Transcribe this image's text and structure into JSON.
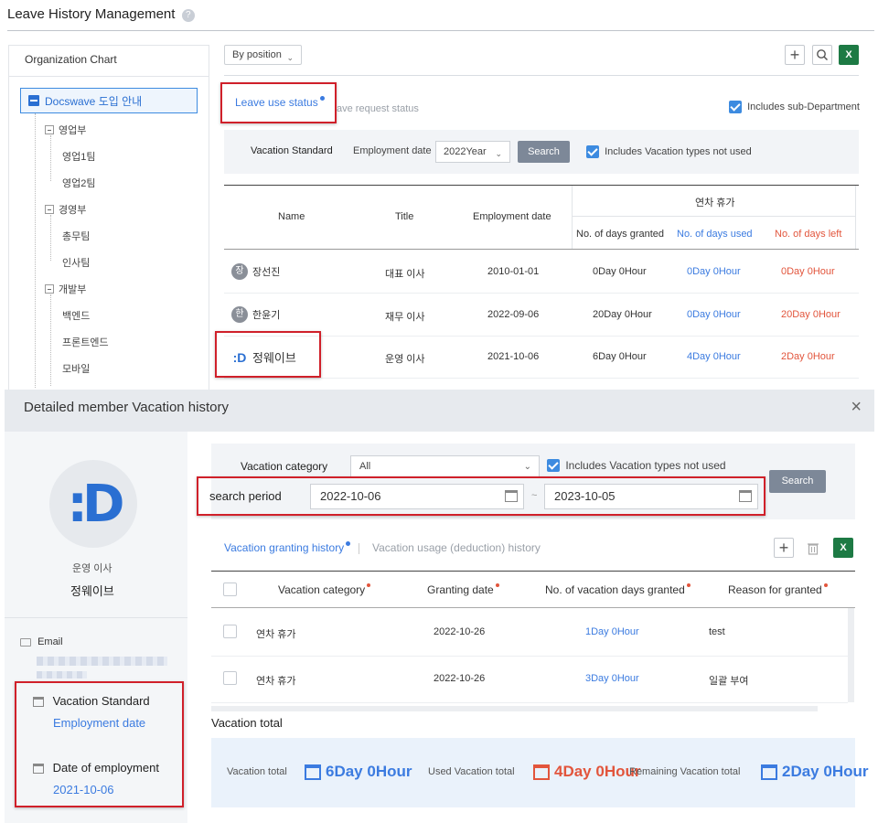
{
  "page": {
    "title": "Leave History Management",
    "help": "?"
  },
  "org": {
    "header": "Organization Chart",
    "root": "Docswave 도입 안내",
    "items": [
      {
        "label": "영업부",
        "level": 1
      },
      {
        "label": "영업1팀",
        "level": 2
      },
      {
        "label": "영업2팀",
        "level": 2
      },
      {
        "label": "경영부",
        "level": 1
      },
      {
        "label": "총무팀",
        "level": 2
      },
      {
        "label": "인사팀",
        "level": 2
      },
      {
        "label": "개발부",
        "level": 1
      },
      {
        "label": "백엔드",
        "level": 2
      },
      {
        "label": "프론트엔드",
        "level": 2
      },
      {
        "label": "모바일",
        "level": 2
      }
    ]
  },
  "toolbar": {
    "view_select": "By position"
  },
  "tabs": {
    "active": "Leave use status",
    "inactive": "ave request status"
  },
  "subdept_label": "Includes sub-Department",
  "filter": {
    "vacation_standard_label": "Vacation Standard",
    "employment_label": "Employment date",
    "year_value": "2022Year",
    "search_label": "Search",
    "not_used_label": "Includes Vacation types not used"
  },
  "table": {
    "headers": {
      "name": "Name",
      "title": "Title",
      "employment": "Employment date",
      "group": "연차 휴가",
      "granted": "No. of days granted",
      "used": "No. of days used",
      "left": "No. of days left"
    },
    "rows": [
      {
        "initial": "장",
        "name": "장선진",
        "title": "대표 이사",
        "date": "2010-01-01",
        "granted": "0Day 0Hour",
        "used": "0Day 0Hour",
        "left": "0Day 0Hour"
      },
      {
        "initial": "한",
        "name": "한윤기",
        "title": "재무 이사",
        "date": "2022-09-06",
        "granted": "20Day 0Hour",
        "used": "0Day 0Hour",
        "left": "20Day 0Hour"
      },
      {
        "initial": ":D",
        "name": "정웨이브",
        "title": "운영 이사",
        "date": "2021-10-06",
        "granted": "6Day 0Hour",
        "used": "4Day 0Hour",
        "left": "2Day 0Hour"
      }
    ]
  },
  "modal": {
    "title": "Detailed member Vacation history",
    "member": {
      "avatar": ":D",
      "position": "운영 이사",
      "name": "정웨이브",
      "email_label": "Email",
      "vacation_standard_label": "Vacation Standard",
      "vacation_standard_value": "Employment date",
      "doe_label": "Date of employment",
      "doe_value": "2021-10-06"
    },
    "filter": {
      "category_label": "Vacation category",
      "category_value": "All",
      "not_used_label": "Includes Vacation types not used",
      "period_label": "search period",
      "start": "2022-10-06",
      "sep": "~",
      "end": "2023-10-05",
      "search": "Search"
    },
    "tabs": {
      "active": "Vacation granting history",
      "inactive": "Vacation usage (deduction) history"
    },
    "grid": {
      "headers": {
        "category": "Vacation category",
        "date": "Granting date",
        "days": "No. of vacation days granted",
        "reason": "Reason for granted"
      },
      "rows": [
        {
          "category": "연차 휴가",
          "date": "2022-10-26",
          "days": "1Day 0Hour",
          "reason": "test"
        },
        {
          "category": "연차 휴가",
          "date": "2022-10-26",
          "days": "3Day 0Hour",
          "reason": "일괄 부여"
        }
      ]
    },
    "total": {
      "heading": "Vacation total",
      "vac_label": "Vacation total",
      "vac_value": "6Day 0Hour",
      "used_label": "Used Vacation total",
      "used_value": "4Day 0Hour",
      "rem_label": "Remaining Vacation total",
      "rem_value": "2Day 0Hour"
    }
  }
}
